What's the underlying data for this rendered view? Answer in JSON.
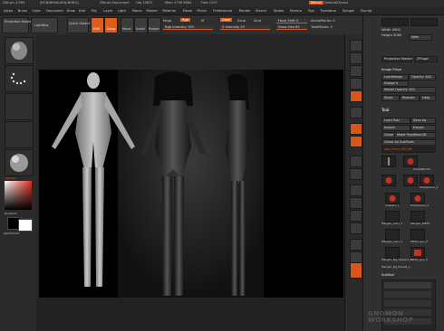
{
  "title_bar": {
    "app": "ZBrush 3.5R3",
    "build": "[ROJK-BHAK-AFAJ-BHDG]",
    "doc": "ZBrush Document",
    "polys": "Obj 15872",
    "mem": "Mem 2798 5884",
    "free": "Free 1297",
    "menus_btn": "Menus",
    "script": "DefaultZScript"
  },
  "menu_bar": [
    "Alpha",
    "Brush",
    "Color",
    "Document",
    "Draw",
    "Edit",
    "File",
    "Layer",
    "Light",
    "Macro",
    "Marker",
    "Material",
    "Movie",
    "Picker",
    "Preferences",
    "Render",
    "Stencil",
    "Stroke",
    "Texture",
    "Tool",
    "Transform",
    "Zplugin",
    "Zscript"
  ],
  "toolbar": {
    "projection_master": "Projection Master",
    "lightbox": "LightBox",
    "quick_sketch": "Quick Sketch",
    "edit": "Edit",
    "draw": "Draw",
    "move": "Move",
    "scale": "Scale",
    "rotate": "Rotate",
    "mrgb": "Mrgb",
    "rgb": "Rgb",
    "m": "M",
    "zadd": "Zadd",
    "zsub": "Zsub",
    "zcut": "Zcut",
    "rgb_intensity": "Rgb Intensity 100",
    "z_intensity": "Z Intensity 25",
    "focal_shift": "Focal Shift 0",
    "draw_size": "Draw Size 64",
    "active_points": "ActivePoints: 0",
    "total_points": "TotalPoints: 0"
  },
  "left_shelf": {
    "material_label": "MatCap",
    "gradient": "Gradient",
    "switch_color": "SwitchColor"
  },
  "right_panel": {
    "width_label": "Width 4000",
    "height_label": "Height 3080",
    "new_btn": "New",
    "projection_master": "Projection Master",
    "zplugin": "ZPlugin",
    "image_plane": "Image Plane",
    "load_image": "LoadImage",
    "opacity": "Opacity 100",
    "nudge": "Nudge 0",
    "model_opacity": "Model Opacity 100",
    "store": "Store",
    "restore": "Restore",
    "help": "Help",
    "tool_header": "Tool",
    "load_tool": "Load Tool",
    "save_as": "Save As",
    "import": "Import",
    "export": "Export",
    "clone": "Clone",
    "make_polymesh": "Make PolyMesh3D",
    "clone_all": "Clone All SubTools",
    "current_tool": "Ayo_Final_OBJ 48",
    "tools": [
      "SimpleBrush",
      "Clippers_1",
      "PolySphere_1",
      "Merged_meri_1",
      "Merged_PM3D",
      "Merged_meri_1",
      "Merged_Bg_Clippers_1",
      "PM3D_Ayo_3",
      "PM3D_Ayo_5",
      "Merged_Bg_PlaneS_1"
    ],
    "subtool_header": "SubTool"
  },
  "watermark": "GNOMON WORKSHOP",
  "colors": {
    "accent": "#e05a1c",
    "panel": "#303030",
    "canvas": "#000000"
  }
}
